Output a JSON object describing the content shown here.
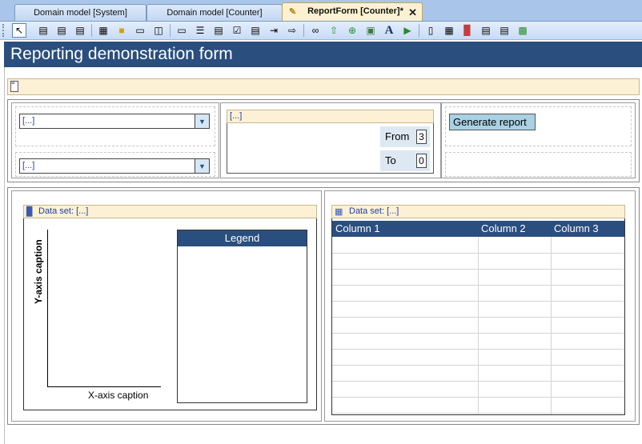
{
  "tabs": [
    {
      "label": "Domain model [System]"
    },
    {
      "label": "Domain model [Counter]"
    },
    {
      "label": "ReportForm [Counter]*"
    }
  ],
  "toolbar": {
    "icons": [
      "pointer-icon",
      "form-icon",
      "form-icon",
      "form-icon",
      "grid-icon",
      "folder-icon",
      "panel-icon",
      "split-icon",
      "label-icon",
      "text-icon",
      "textbox-icon",
      "checkbox-icon",
      "combo-icon",
      "move-right-icon",
      "move-list-icon",
      "link-icon",
      "upload-icon",
      "add-icon",
      "image-icon",
      "font-icon",
      "play-icon",
      "column-icon",
      "table-icon",
      "chart-icon",
      "report-icon",
      "list-icon",
      "export-icon"
    ]
  },
  "banner": {
    "title": "Reporting demonstration form"
  },
  "filters": {
    "combo1": "[...]",
    "combo2": "[...]",
    "range_header": "[...]",
    "from_label": "From",
    "from_value": "3",
    "to_label": "To",
    "to_value": "0",
    "generate_label": "Generate report"
  },
  "chart": {
    "header": "Data set: [...]",
    "ycaption": "Y-axis caption",
    "xcaption": "X-axis caption",
    "legend": "Legend"
  },
  "table": {
    "header": "Data set: [...]",
    "columns": [
      "Column 1",
      "Column 2",
      "Column 3"
    ]
  },
  "colors": {
    "banner": "#2a4e7e",
    "accent_header": "#fdf1d5",
    "button": "#a9d1e3"
  }
}
